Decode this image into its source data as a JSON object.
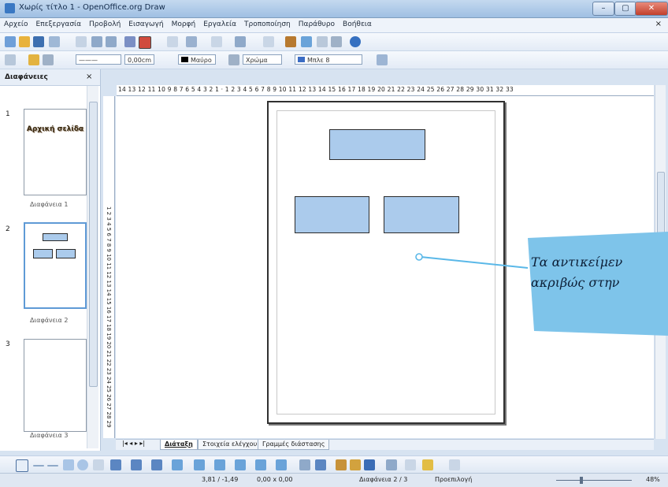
{
  "window": {
    "title": "Χωρίς τίτλο 1 - OpenOffice.org Draw",
    "controls": [
      "–",
      "▢",
      "✕"
    ]
  },
  "menu": [
    "Αρχείο",
    "Επεξεργασία",
    "Προβολή",
    "Εισαγωγή",
    "Μορφή",
    "Εργαλεία",
    "Τροποποίηση",
    "Παράθυρο",
    "Βοήθεια"
  ],
  "toolbar2": {
    "line_width": "0,00cm",
    "line_color": "Μαύρο",
    "fill_type": "Χρώμα",
    "fill_color": "Μπλε 8"
  },
  "slides_pane": {
    "title": "Διαφάνειες",
    "close": "×",
    "thumbs": [
      {
        "num": "1",
        "label": "Διαφάνεια 1",
        "text": "Αρχική σελίδα"
      },
      {
        "num": "2",
        "label": "Διαφάνεια 2"
      },
      {
        "num": "3",
        "label": "Διαφάνεια 3"
      }
    ]
  },
  "hruler_text": "14 13 12 11 10 9 8 7 6 5 4 3 2 1 · 1 2 3 4 5 6 7 8 9 10 11 12 13 14 15 16 17 18 19 20 21 22 23 24 25 26 27 28 29 30 31 32 33",
  "vruler_text": "1 2 3 4 5 6 7 8 9 10 11 12 13 14 15 16 17 18 19 20 21 22 23 24 25 26 27 28 29",
  "tabs": [
    "Διάταξη",
    "Στοιχεία ελέγχου",
    "Γραμμές διάστασης"
  ],
  "status": {
    "position": "3,81 / -1,49",
    "size": "0,00 x 0,00",
    "page": "Διαφάνεια 2 / 3",
    "layout": "Προεπιλογή",
    "zoom": "48%"
  },
  "callout": {
    "line1": "Τα αντικείμεν",
    "line2": "ακριβώς στην"
  },
  "colors": {
    "shape_fill": "#abcbec",
    "callout_fill": "#7ec4ea",
    "callout_line": "#5ab8e8"
  }
}
